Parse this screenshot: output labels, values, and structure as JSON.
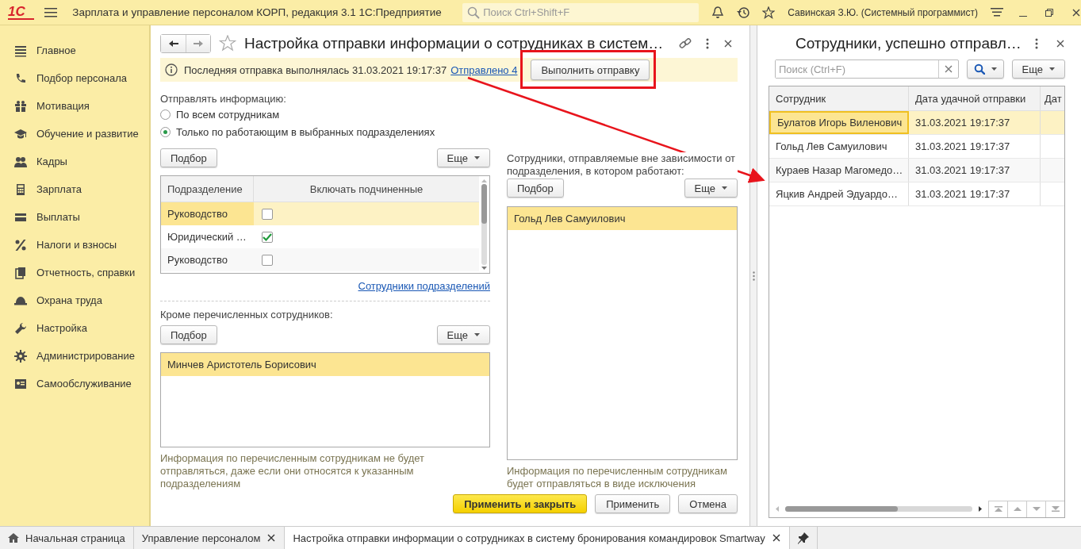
{
  "app": {
    "logo": "1С",
    "title": "Зарплата и управление персоналом КОРП, редакция 3.1 1С:Предприятие",
    "search_placeholder": "Поиск Ctrl+Shift+F",
    "user": "Савинская З.Ю. (Системный программист)"
  },
  "sidebar": {
    "items": [
      {
        "label": "Главное"
      },
      {
        "label": "Подбор персонала"
      },
      {
        "label": "Мотивация"
      },
      {
        "label": "Обучение и развитие"
      },
      {
        "label": "Кадры"
      },
      {
        "label": "Зарплата"
      },
      {
        "label": "Выплаты"
      },
      {
        "label": "Налоги и взносы"
      },
      {
        "label": "Отчетность, справки"
      },
      {
        "label": "Охрана труда"
      },
      {
        "label": "Настройка"
      },
      {
        "label": "Администрирование"
      },
      {
        "label": "Самообслуживание"
      }
    ]
  },
  "form": {
    "title": "Настройка отправки информации о сотрудниках в систем…",
    "info": {
      "text": "Последняя отправка выполнялась 31.03.2021 19:17:37",
      "link": "Отправлено 4"
    },
    "send_button": "Выполнить отправку",
    "send_label": "Отправлять информацию:",
    "radios": [
      {
        "label": "По всем сотрудникам",
        "selected": false
      },
      {
        "label": "Только по работающим в выбранных подразделениях",
        "selected": true
      }
    ],
    "departments": {
      "pick_button": "Подбор",
      "more_button": "Еще",
      "columns": [
        "Подразделение",
        "Включать подчиненные"
      ],
      "rows": [
        {
          "name": "Руководство",
          "include_subordinates": false,
          "selected": true
        },
        {
          "name": "Юридический …",
          "include_subordinates": true,
          "selected": false
        },
        {
          "name": "Руководство",
          "include_subordinates": false,
          "selected": false
        }
      ],
      "link": "Сотрудники подразделений"
    },
    "excluded": {
      "label": "Кроме перечисленных сотрудников:",
      "pick_button": "Подбор",
      "more_button": "Еще",
      "rows": [
        {
          "name": "Минчев Аристотель Борисович",
          "selected": true
        }
      ],
      "note": "Информация по перечисленным сотрудникам не будет отправляться, даже если они относятся к указанным подразделениям"
    },
    "always": {
      "label": "Сотрудники, отправляемые вне зависимости от подразделения, в котором работают:",
      "pick_button": "Подбор",
      "more_button": "Еще",
      "rows": [
        {
          "name": "Гольд Лев Самуилович",
          "selected": true
        }
      ],
      "note": "Информация по перечисленным сотрудникам будет отправляться в виде исключения"
    },
    "buttons": [
      {
        "label": "Применить и закрыть",
        "kind": "primary"
      },
      {
        "label": "Применить",
        "kind": "normal"
      },
      {
        "label": "Отмена",
        "kind": "normal"
      }
    ]
  },
  "right_panel": {
    "title": "Сотрудники, успешно отправл…",
    "search_placeholder": "Поиск (Ctrl+F)",
    "more_button": "Еще",
    "columns": [
      "Сотрудник",
      "Дата удачной отправки",
      "Дат"
    ],
    "rows": [
      {
        "employee": "Булатов Игорь Виленович",
        "date": "31.03.2021 19:17:37",
        "selected": true
      },
      {
        "employee": "Гольд Лев Самуилович",
        "date": "31.03.2021 19:17:37",
        "selected": false
      },
      {
        "employee": "Кураев Назар Магомедо…",
        "date": "31.03.2021 19:17:37",
        "selected": false
      },
      {
        "employee": "Яцкив Андрей Эдуардо…",
        "date": "31.03.2021 19:17:37",
        "selected": false
      }
    ]
  },
  "taskbar": {
    "tabs": [
      {
        "label": "Начальная страница",
        "kind": "home",
        "selected": false
      },
      {
        "label": "Управление персоналом",
        "kind": "closable",
        "selected": false
      },
      {
        "label": "Настройка отправки информации о сотрудниках в систему бронирования командировок Smartway",
        "kind": "closable",
        "selected": true
      }
    ]
  }
}
